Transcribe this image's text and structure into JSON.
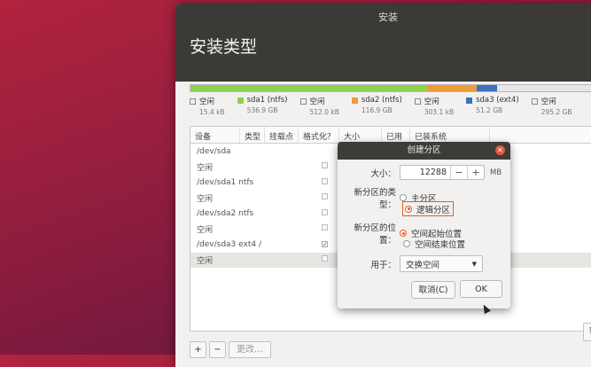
{
  "window": {
    "title": "安装",
    "header": "安装类型"
  },
  "partitions": [
    {
      "name": "空闲",
      "size": "15.4 kB",
      "color": "#ffffff"
    },
    {
      "name": "sda1 (ntfs)",
      "size": "536.9 GB",
      "color": "#8fd14f"
    },
    {
      "name": "空闲",
      "size": "512.0 kB",
      "color": "#ffffff"
    },
    {
      "name": "sda2 (ntfs)",
      "size": "116.9 GB",
      "color": "#ef9a3b"
    },
    {
      "name": "空闲",
      "size": "303.1 kB",
      "color": "#ffffff"
    },
    {
      "name": "sda3 (ext4)",
      "size": "51.2 GB",
      "color": "#3e6fc2"
    },
    {
      "name": "空闲",
      "size": "295.2 GB",
      "color": "#ffffff"
    }
  ],
  "partition_bar": [
    {
      "fraction": 0.57,
      "color": "#8fd14f"
    },
    {
      "fraction": 0.12,
      "color": "#ef9a3b"
    },
    {
      "fraction": 0.05,
      "color": "#3e6fc2"
    },
    {
      "fraction": 0.26,
      "color": "#e6e6e6"
    }
  ],
  "table": {
    "headers": [
      "设备",
      "类型",
      "挂载点",
      "格式化？",
      "大小",
      "已用",
      "已装系统"
    ],
    "rows": [
      {
        "device": "/dev/sda",
        "format": ""
      },
      {
        "device": "空闲",
        "format": "off"
      },
      {
        "device": "/dev/sda1 ntfs",
        "format": "off"
      },
      {
        "device": "空闲",
        "format": "off"
      },
      {
        "device": "/dev/sda2 ntfs",
        "format": "off"
      },
      {
        "device": "空闲",
        "format": "off"
      },
      {
        "device": "/dev/sda3 ext4  /",
        "format": "on"
      },
      {
        "device": "空闲",
        "format": "off"
      }
    ],
    "selected_row": 7
  },
  "toolbar": {
    "add": "+",
    "remove": "−",
    "change": "更改...",
    "new_table": "新建分区"
  },
  "dialog": {
    "title": "创建分区",
    "size_label": "大小：",
    "size_value": "12288",
    "size_minus": "−",
    "size_plus": "+",
    "size_unit": "MB",
    "type_label": "新分区的类型：",
    "type_primary": "主分区",
    "type_logical": "逻辑分区",
    "location_label": "新分区的位置：",
    "location_start": "空间起始位置",
    "location_end": "空间结束位置",
    "use_label": "用于：",
    "use_value": "交换空间",
    "cancel": "取消(C)",
    "ok": "OK"
  }
}
